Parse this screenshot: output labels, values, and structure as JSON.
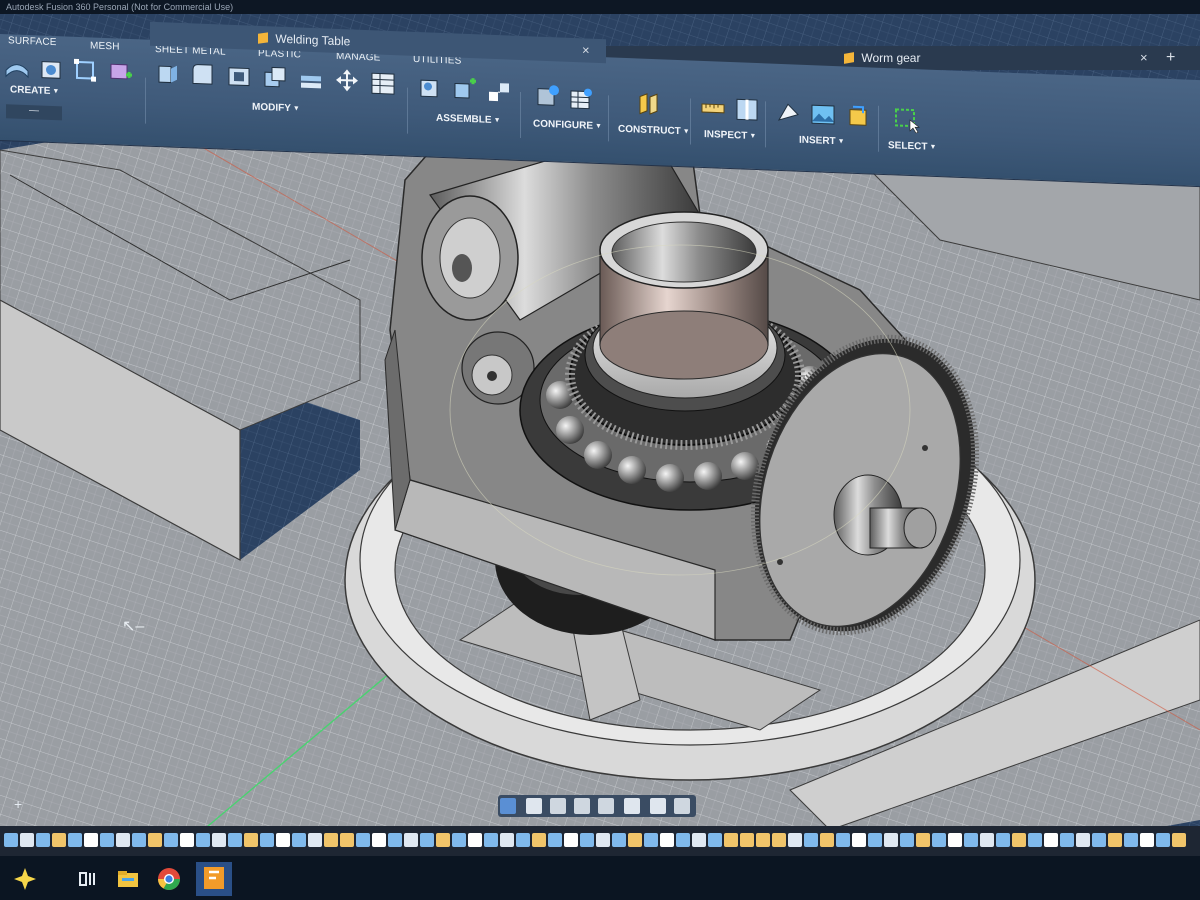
{
  "window": {
    "title": "Autodesk Fusion 360 Personal (Not for Commercial Use)"
  },
  "document_tabs": [
    {
      "label": "Welding Table",
      "active": true
    },
    {
      "label": "Worm gear",
      "active": false
    }
  ],
  "ribbon": {
    "tabs": [
      "SURFACE",
      "MESH",
      "SHEET METAL",
      "PLASTIC",
      "MANAGE",
      "UTILITIES"
    ],
    "groups": {
      "create": "CREATE",
      "modify": "MODIFY",
      "assemble": "ASSEMBLE",
      "configure": "CONFIGURE",
      "construct": "CONSTRUCT",
      "inspect": "INSPECT",
      "insert": "INSERT",
      "select": "SELECT"
    },
    "collapse_label": "—"
  },
  "bottom": {
    "add_label": "+",
    "new_tab_label": "+",
    "close_label": "×"
  },
  "colors": {
    "ribbon": "#4a6585",
    "viewport_grid": "#2a3f5c",
    "model_gray": "#cfcfcf",
    "accent_yellow": "#f4b53a",
    "timeline_bg": "#1e2633",
    "taskbar_bg": "#0b1522"
  },
  "icons": {
    "navbar": [
      "orbit-icon",
      "pan-icon",
      "look-at-icon",
      "zoom-icon",
      "display-settings-icon",
      "grid-icon",
      "viewports-icon"
    ],
    "taskbar": [
      "start-icon",
      "task-view-icon",
      "file-explorer-icon",
      "chrome-icon",
      "fusion-icon"
    ]
  }
}
